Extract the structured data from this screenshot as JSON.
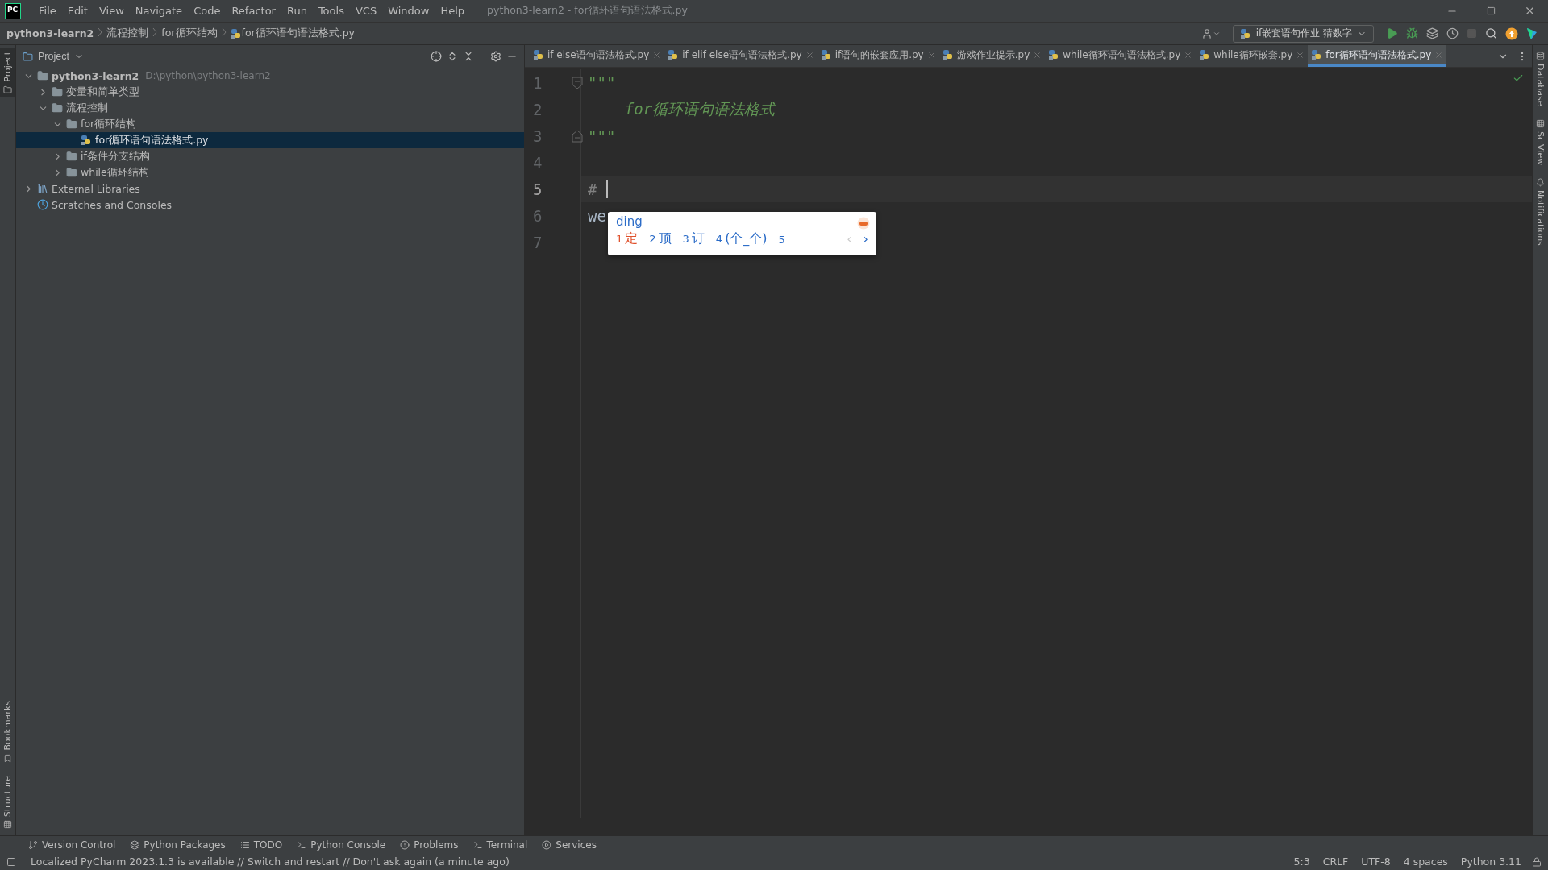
{
  "window": {
    "logo": "PC",
    "title": "python3-learn2 - for循环语句语法格式.py"
  },
  "menu": [
    "File",
    "Edit",
    "View",
    "Navigate",
    "Code",
    "Refactor",
    "Run",
    "Tools",
    "VCS",
    "Window",
    "Help"
  ],
  "breadcrumbs": [
    "python3-learn2",
    "流程控制",
    "for循环结构",
    "for循环语句语法格式.py"
  ],
  "run_config": "if嵌套语句作业 猜数字",
  "left_strip": {
    "top": [
      {
        "label": "Project",
        "selected": true
      }
    ],
    "bottom": [
      {
        "label": "Bookmarks",
        "selected": false
      },
      {
        "label": "Structure",
        "selected": false
      }
    ]
  },
  "right_strip": [
    "Database",
    "SciView",
    "Notifications"
  ],
  "project": {
    "title": "Project",
    "tree": [
      {
        "label": "python3-learn2",
        "path": "D:\\python\\python3-learn2",
        "kind": "folder",
        "expanded": true,
        "selected": false,
        "children": [
          {
            "label": "变量和简单类型",
            "kind": "folder",
            "expanded": false,
            "selected": false
          },
          {
            "label": "流程控制",
            "kind": "folder",
            "expanded": true,
            "selected": false,
            "children": [
              {
                "label": "for循环结构",
                "kind": "folder",
                "expanded": true,
                "selected": false,
                "children": [
                  {
                    "label": "for循环语句语法格式.py",
                    "kind": "python",
                    "selected": true
                  }
                ]
              },
              {
                "label": "if条件分支结构",
                "kind": "folder",
                "expanded": false,
                "selected": false
              },
              {
                "label": "while循环结构",
                "kind": "folder",
                "expanded": false,
                "selected": false
              }
            ]
          }
        ]
      },
      {
        "label": "External Libraries",
        "kind": "library",
        "expanded": false,
        "selected": false
      },
      {
        "label": "Scratches and Consoles",
        "kind": "scratch",
        "selected": false
      }
    ]
  },
  "tabs": [
    {
      "label": "if else语句语法格式.py",
      "selected": false
    },
    {
      "label": "if elif else语句语法格式.py",
      "selected": false
    },
    {
      "label": "if语句的嵌套应用.py",
      "selected": false
    },
    {
      "label": "游戏作业提示.py",
      "selected": false
    },
    {
      "label": "while循环语句语法格式.py",
      "selected": false
    },
    {
      "label": "while循环嵌套.py",
      "selected": false
    },
    {
      "label": "for循环语句语法格式.py",
      "selected": true
    }
  ],
  "editor": {
    "lines": [
      {
        "number": "1",
        "text": "\"\"\"",
        "kind": "docstring",
        "fold_start": true,
        "current": false
      },
      {
        "number": "2",
        "text": "    for循环语句语法格式",
        "kind": "docstring",
        "current": false
      },
      {
        "number": "3",
        "text": "\"\"\"",
        "kind": "docstring",
        "fold_end": true,
        "current": false
      },
      {
        "number": "4",
        "current": false
      },
      {
        "number": "5",
        "text": "# ",
        "kind": "comment",
        "current": true
      },
      {
        "number": "6",
        "text": "we",
        "kind": "code",
        "current": false
      },
      {
        "number": "7",
        "current": false
      }
    ]
  },
  "ime": {
    "input": "ding",
    "candidates": [
      {
        "index": "1",
        "text": "定",
        "selected": true
      },
      {
        "index": "2",
        "text": "顶",
        "selected": false
      },
      {
        "index": "3",
        "text": "订",
        "selected": false
      },
      {
        "index": "4",
        "text": "(个_个)",
        "selected": false
      },
      {
        "index": "5",
        "selected": false
      }
    ],
    "prev": "‹",
    "next": "›"
  },
  "tool_windows": [
    {
      "label": "Version Control",
      "kind": "vcs"
    },
    {
      "label": "Python Packages",
      "kind": "packages"
    },
    {
      "label": "TODO",
      "kind": "todo"
    },
    {
      "label": "Python Console",
      "kind": "console"
    },
    {
      "label": "Problems",
      "kind": "problems"
    },
    {
      "label": "Terminal",
      "kind": "terminal"
    },
    {
      "label": "Services",
      "kind": "services"
    }
  ],
  "status": {
    "message": "Localized PyCharm 2023.1.3 is available // Switch and restart // Don't ask again (a minute ago)",
    "items": [
      "5:3",
      "CRLF",
      "UTF-8",
      "4 spaces",
      "Python 3.11"
    ]
  }
}
